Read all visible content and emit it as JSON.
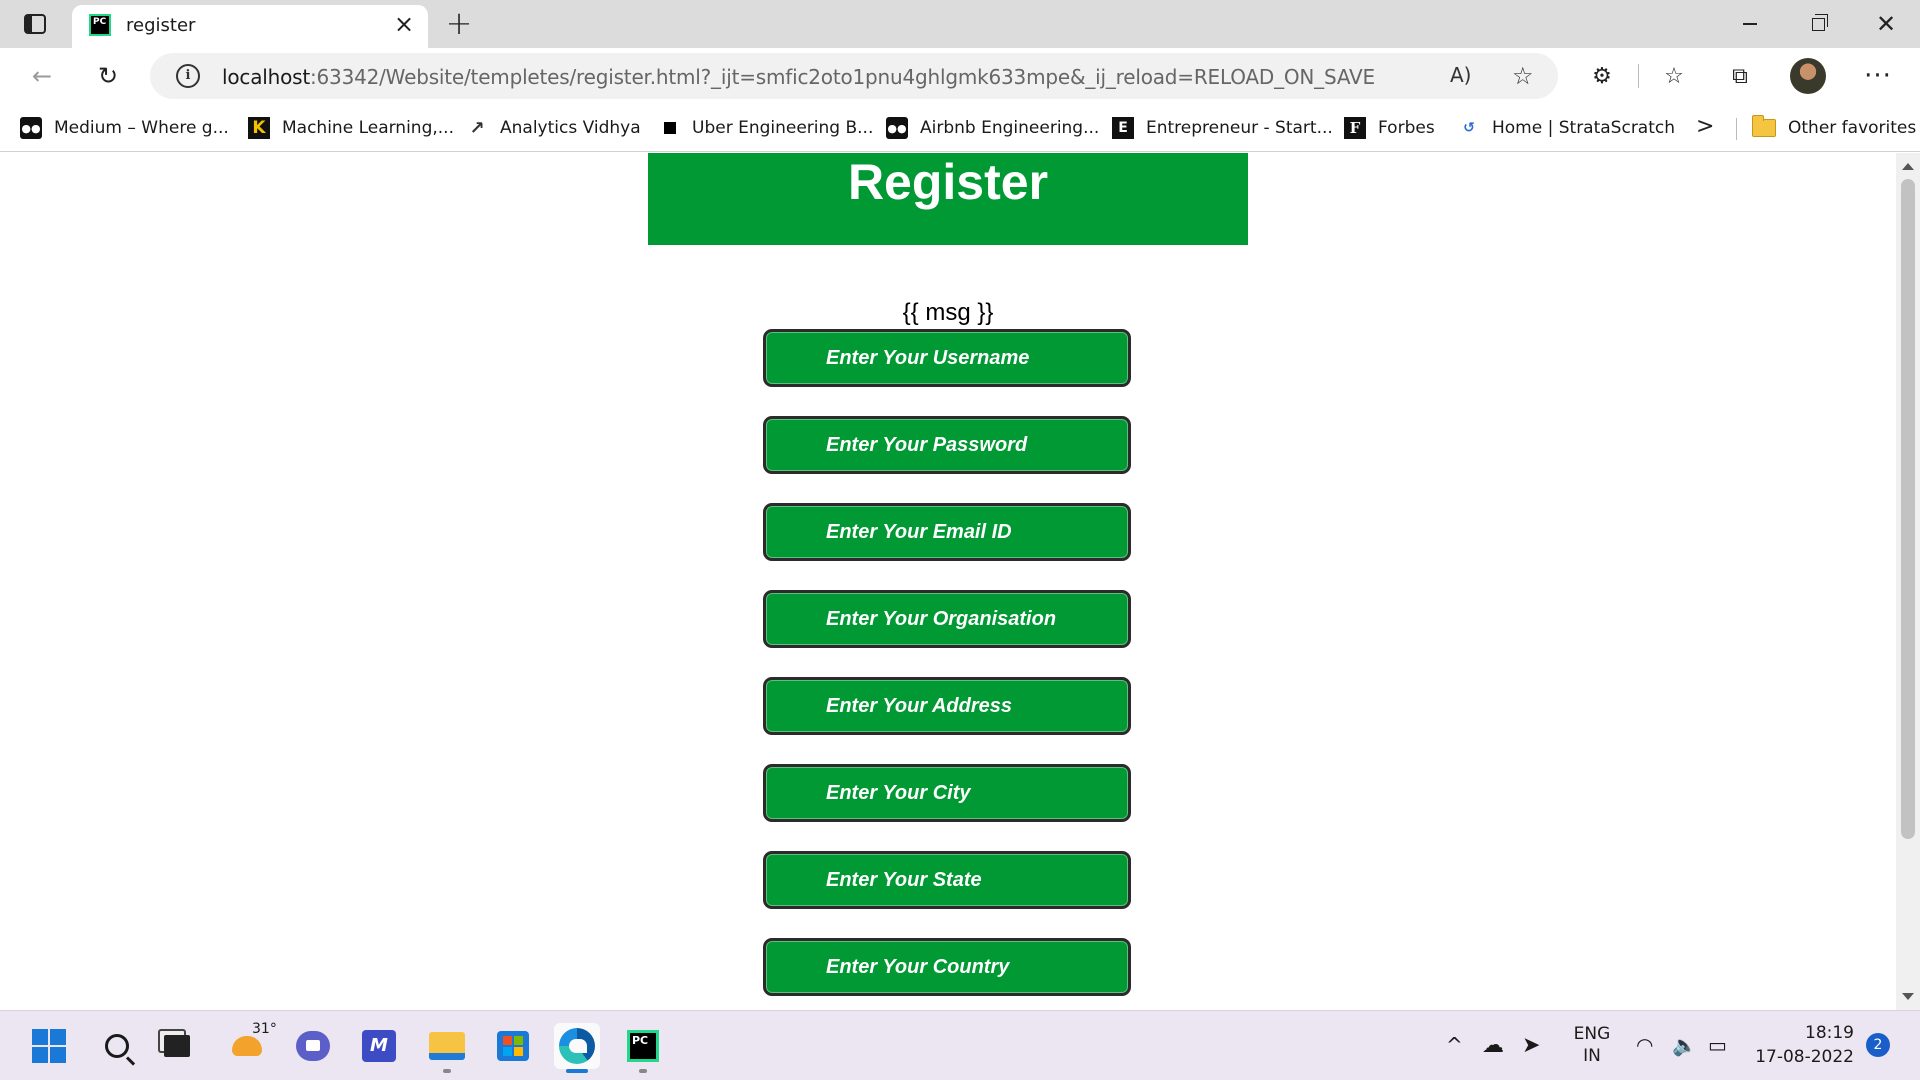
{
  "browser": {
    "tab_title": "register",
    "tab_favicon_text": "PC",
    "url_host": "localhost",
    "url_rest": ":63342/Website/templetes/register.html?_ijt=smfic2oto1pnu4ghlgmk633mpe&_ij_reload=RELOAD_ON_SAVE",
    "read_aloud_glyph": "A)",
    "icons": [
      "tab-actions-icon",
      "close-icon",
      "plus-icon",
      "back-icon",
      "reload-icon",
      "info-icon",
      "read-aloud-icon",
      "add-favorite-icon",
      "extensions-icon",
      "favorites-icon",
      "collections-icon",
      "profile-avatar",
      "more-icon",
      "minimize-icon",
      "maximize-icon",
      "window-close-icon"
    ]
  },
  "bookmarks": {
    "items": [
      {
        "label": "Medium – Where g...",
        "icon": "medium-icon",
        "glyph": "●●"
      },
      {
        "label": "Machine Learning,...",
        "icon": "kaggle-icon",
        "glyph": "K"
      },
      {
        "label": "Analytics Vidhya",
        "icon": "analytics-vidhya-icon",
        "glyph": "↗"
      },
      {
        "label": "Uber Engineering B...",
        "icon": "uber-icon",
        "glyph": ""
      },
      {
        "label": "Airbnb Engineering...",
        "icon": "medium-icon",
        "glyph": "●●"
      },
      {
        "label": "Entrepreneur - Start...",
        "icon": "entrepreneur-icon",
        "glyph": "E"
      },
      {
        "label": "Forbes",
        "icon": "forbes-icon",
        "glyph": "F"
      },
      {
        "label": "Home | StrataScratch",
        "icon": "stratascratch-icon",
        "glyph": "↺"
      }
    ],
    "overflow_glyph": ">",
    "other_favorites": "Other favorites"
  },
  "page": {
    "header": "Register",
    "message": "{{ msg }}",
    "fields": [
      {
        "placeholder": "Enter Your Username"
      },
      {
        "placeholder": "Enter Your Password"
      },
      {
        "placeholder": "Enter Your Email ID"
      },
      {
        "placeholder": "Enter Your Organisation"
      },
      {
        "placeholder": "Enter Your Address"
      },
      {
        "placeholder": "Enter Your City"
      },
      {
        "placeholder": "Enter Your State"
      },
      {
        "placeholder": "Enter Your Country"
      }
    ],
    "colors": {
      "accent_green": "#009933",
      "field_border": "#2b2b2b"
    }
  },
  "taskbar": {
    "weather_temp": "31°",
    "mail_glyph": "M",
    "pycharm_glyph": "PC",
    "language_top": "ENG",
    "language_bottom": "IN",
    "time": "18:19",
    "date": "17-08-2022",
    "notification_count": "2",
    "icons": [
      "windows-start-icon",
      "search-icon",
      "task-view-icon",
      "weather-icon",
      "teams-chat-icon",
      "mail-app-icon",
      "file-explorer-icon",
      "microsoft-store-icon",
      "edge-icon",
      "pycharm-icon",
      "chevron-up-icon",
      "onedrive-cloud-icon",
      "location-icon",
      "wifi-icon",
      "volume-icon",
      "battery-icon"
    ]
  }
}
